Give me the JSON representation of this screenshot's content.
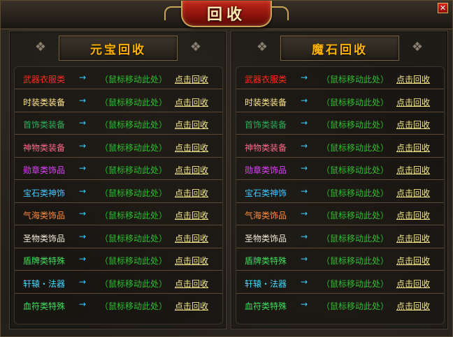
{
  "window": {
    "title": "回收",
    "close_icon": "✕"
  },
  "panels": [
    {
      "title": "元宝回收",
      "ornament": "❖"
    },
    {
      "title": "魔石回收",
      "ornament": "❖"
    }
  ],
  "rows": [
    {
      "name": "武器衣服类",
      "color": "#ff2a1a",
      "arrow": "→",
      "hint": "（鼠标移动此处）",
      "action": "点击回收"
    },
    {
      "name": "时装类装备",
      "color": "#ffe68a",
      "arrow": "→",
      "hint": "（鼠标移动此处）",
      "action": "点击回收"
    },
    {
      "name": "首饰类装备",
      "color": "#2fae5a",
      "arrow": "→",
      "hint": "（鼠标移动此处）",
      "action": "点击回收"
    },
    {
      "name": "神物类装备",
      "color": "#ff6a8a",
      "arrow": "→",
      "hint": "（鼠标移动此处）",
      "action": "点击回收"
    },
    {
      "name": "勋章类饰品",
      "color": "#e040ff",
      "arrow": "→",
      "hint": "（鼠标移动此处）",
      "action": "点击回收"
    },
    {
      "name": "宝石类神饰",
      "color": "#40c8ff",
      "arrow": "→",
      "hint": "（鼠标移动此处）",
      "action": "点击回收"
    },
    {
      "name": "气海类饰品",
      "color": "#ff8a3a",
      "arrow": "→",
      "hint": "（鼠标移动此处）",
      "action": "点击回收"
    },
    {
      "name": "圣物类饰品",
      "color": "#f0ead8",
      "arrow": "→",
      "hint": "（鼠标移动此处）",
      "action": "点击回收"
    },
    {
      "name": "盾牌类特殊",
      "color": "#3ee05a",
      "arrow": "→",
      "hint": "（鼠标移动此处）",
      "action": "点击回收"
    },
    {
      "name": "轩辕・法器",
      "color": "#40d8ff",
      "arrow": "→",
      "hint": "（鼠标移动此处）",
      "action": "点击回收"
    },
    {
      "name": "血符类特殊",
      "color": "#3ee05a",
      "arrow": "→",
      "hint": "（鼠标移动此处）",
      "action": "点击回收"
    }
  ]
}
